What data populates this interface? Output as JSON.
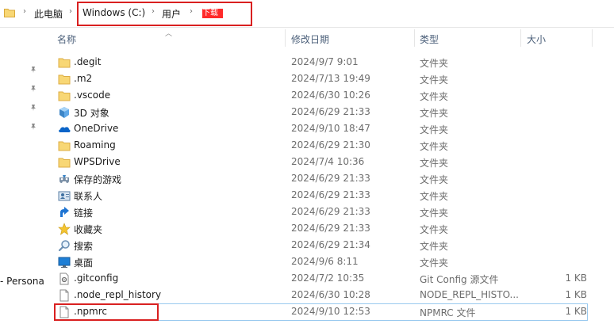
{
  "breadcrumb": {
    "items": [
      "此电脑",
      "Windows (C:)",
      "用户",
      "下载"
    ]
  },
  "nav": {
    "partial_item": "- Persona"
  },
  "columns": {
    "name": "名称",
    "modified": "修改日期",
    "type": "类型",
    "size": "大小"
  },
  "files": [
    {
      "name": ".degit",
      "modified": "2024/9/7 9:01",
      "type": "文件夹",
      "size": "",
      "icon": "folder-icon"
    },
    {
      "name": ".m2",
      "modified": "2024/7/13 19:49",
      "type": "文件夹",
      "size": "",
      "icon": "folder-icon"
    },
    {
      "name": ".vscode",
      "modified": "2024/6/30 10:26",
      "type": "文件夹",
      "size": "",
      "icon": "folder-icon"
    },
    {
      "name": "3D 对象",
      "modified": "2024/6/29 21:33",
      "type": "文件夹",
      "size": "",
      "icon": "3d-objects-icon"
    },
    {
      "name": "OneDrive",
      "modified": "2024/9/10 18:47",
      "type": "文件夹",
      "size": "",
      "icon": "onedrive-icon"
    },
    {
      "name": "Roaming",
      "modified": "2024/6/29 21:30",
      "type": "文件夹",
      "size": "",
      "icon": "folder-icon"
    },
    {
      "name": "WPSDrive",
      "modified": "2024/7/4 10:36",
      "type": "文件夹",
      "size": "",
      "icon": "folder-icon"
    },
    {
      "name": "保存的游戏",
      "modified": "2024/6/29 21:33",
      "type": "文件夹",
      "size": "",
      "icon": "saved-games-icon"
    },
    {
      "name": "联系人",
      "modified": "2024/6/29 21:33",
      "type": "文件夹",
      "size": "",
      "icon": "contacts-icon"
    },
    {
      "name": "链接",
      "modified": "2024/6/29 21:33",
      "type": "文件夹",
      "size": "",
      "icon": "links-icon"
    },
    {
      "name": "收藏夹",
      "modified": "2024/6/29 21:33",
      "type": "文件夹",
      "size": "",
      "icon": "favorites-icon"
    },
    {
      "name": "搜索",
      "modified": "2024/6/29 21:34",
      "type": "文件夹",
      "size": "",
      "icon": "searches-icon"
    },
    {
      "name": "桌面",
      "modified": "2024/9/6 8:11",
      "type": "文件夹",
      "size": "",
      "icon": "desktop-icon"
    },
    {
      "name": ".gitconfig",
      "modified": "2024/7/2 10:35",
      "type": "Git Config 源文件",
      "size": "1 KB",
      "icon": "config-file-icon"
    },
    {
      "name": ".node_repl_history",
      "modified": "2024/6/30 10:28",
      "type": "NODE_REPL_HISTO...",
      "size": "1 KB",
      "icon": "file-icon"
    },
    {
      "name": ".npmrc",
      "modified": "2024/9/10 12:53",
      "type": "NPMRC 文件",
      "size": "1 KB",
      "icon": "file-icon"
    }
  ],
  "colors": {
    "folder": "#f8d775",
    "highlight": "#d92020",
    "header_text": "#4c607a"
  }
}
